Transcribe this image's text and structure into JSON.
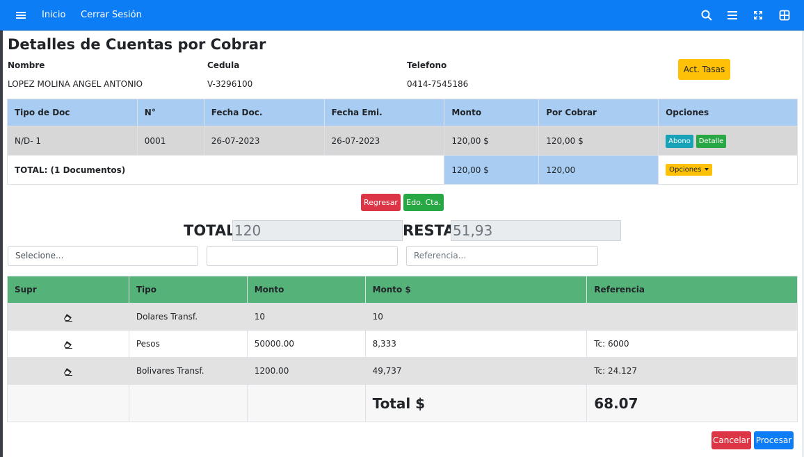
{
  "navbar": {
    "menu_icon": "hamburger-icon",
    "inicio": "Inicio",
    "cerrar_sesion": "Cerrar Sesión",
    "right_icons": [
      "search-icon",
      "list-icon",
      "fullscreen-icon",
      "grid-icon"
    ],
    "color": "#0d7df5"
  },
  "page": {
    "title": "Detalles de Cuentas por Cobrar"
  },
  "client": {
    "nombre_label": "Nombre",
    "nombre_value": "LOPEZ MOLINA ANGEL ANTONIO",
    "cedula_label": "Cedula",
    "cedula_value": "V-3296100",
    "telefono_label": "Telefono",
    "telefono_value": "0414-7545186",
    "act_tasas_label": "Act. Tasas"
  },
  "documents_table": {
    "headers": [
      "Tipo de Doc",
      "N°",
      "Fecha Doc.",
      "Fecha Emi.",
      "Monto",
      "Por Cobrar",
      "Opciones"
    ],
    "rows": [
      {
        "tipo": "N/D- 1",
        "numero": "0001",
        "fecha_doc": "26-07-2023",
        "fecha_emi": "26-07-2023",
        "monto": "120,00 $",
        "por_cobrar": "120,00 $",
        "abono_label": "Abono",
        "detalle_label": "Detalle"
      }
    ],
    "total_label": "TOTAL: (1 Documentos)",
    "total_monto": "120,00 $",
    "total_por_cobrar": "120,00",
    "opciones_label": "Opciones"
  },
  "actions": {
    "regresar_label": "Regresar",
    "edo_cta_label": "Edo. Cta."
  },
  "summary": {
    "total_label": "TOTAL",
    "total_value": "120",
    "resta_label": "RESTA",
    "resta_value": "51,93"
  },
  "payment_form": {
    "tipo_placeholder": "Selecione...",
    "monto_value": "",
    "referencia_placeholder": "Referencia..."
  },
  "payments_table": {
    "headers": [
      "Supr",
      "Tipo",
      "Monto",
      "Monto $",
      "Referencia"
    ],
    "rows": [
      {
        "tipo": "Dolares Transf.",
        "monto": "10",
        "monto_usd": "10",
        "referencia": ""
      },
      {
        "tipo": "Pesos",
        "monto": "50000.00",
        "monto_usd": "8,333",
        "referencia": "Tc: 6000"
      },
      {
        "tipo": "Bolivares Transf.",
        "monto": "1200.00",
        "monto_usd": "49,737",
        "referencia": "Tc: 24.127"
      }
    ],
    "total_label": "Total $",
    "total_value": "68.07",
    "delete_icon": "eraser-icon"
  },
  "footer": {
    "cancelar_label": "Cancelar",
    "procesar_label": "Procesar"
  }
}
